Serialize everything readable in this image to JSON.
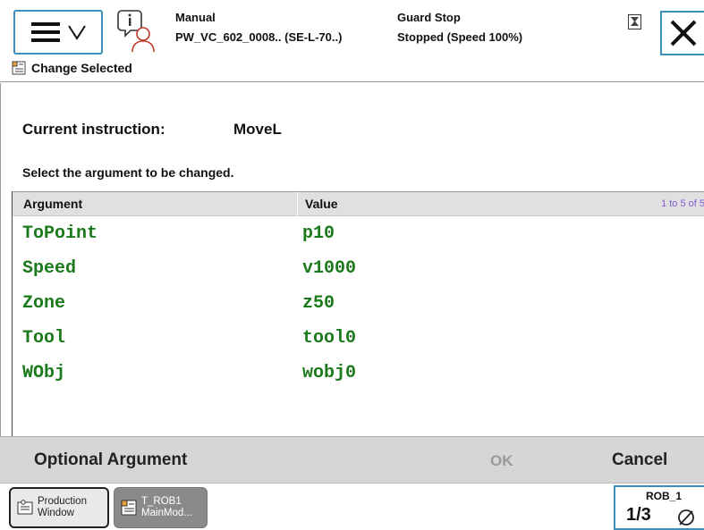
{
  "header": {
    "mode": "Manual",
    "controller": "PW_VC_602_0008.. (SE-L-70..)",
    "guard_state": "Guard Stop",
    "run_state": "Stopped (Speed 100%)"
  },
  "breadcrumb": {
    "label": "Change Selected"
  },
  "main": {
    "current_label": "Current instruction:",
    "current_value": "MoveL",
    "instruction": "Select the argument to be changed.",
    "table": {
      "col_argument": "Argument",
      "col_value": "Value",
      "range": "1 to 5 of 5",
      "rows": [
        {
          "argument": "ToPoint",
          "value": "p10"
        },
        {
          "argument": "Speed",
          "value": "v1000"
        },
        {
          "argument": "Zone",
          "value": "z50"
        },
        {
          "argument": "Tool",
          "value": "tool0"
        },
        {
          "argument": "WObj",
          "value": "wobj0"
        }
      ]
    }
  },
  "actions": {
    "optional": "Optional Argument",
    "ok": "OK",
    "cancel": "Cancel"
  },
  "taskbar": {
    "production_line1": "Production",
    "production_line2": "Window",
    "rob_line1": "T_ROB1",
    "rob_line2": "MainMod...",
    "robot_name": "ROB_1",
    "speed_fraction": "1/3"
  },
  "colors": {
    "accent_border": "#3c8fb8",
    "code_green": "#1b7a1b",
    "range_purple": "#7f5bd4"
  }
}
